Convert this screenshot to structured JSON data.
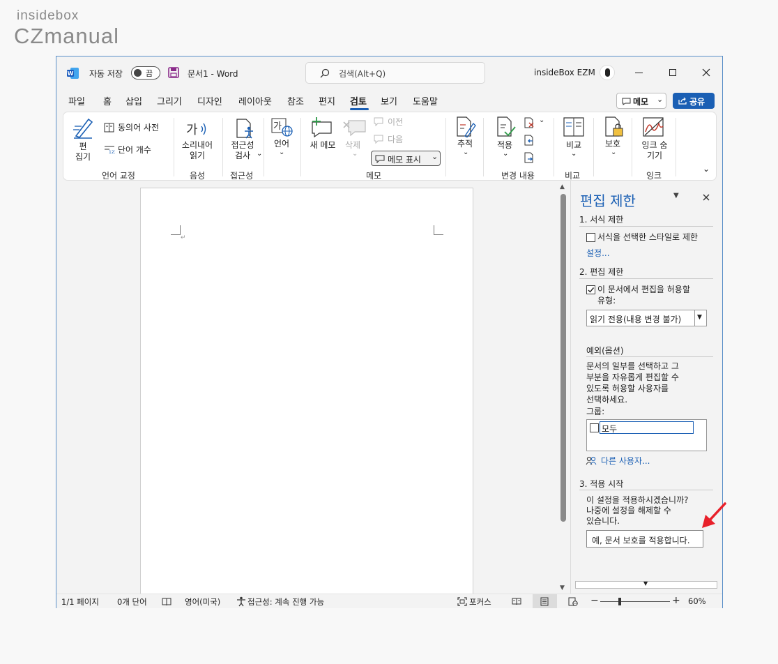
{
  "brand": {
    "line1": "insidebox",
    "line2": "CZmanual"
  },
  "titlebar": {
    "autosave_label": "자동 저장",
    "autosave_state": "끔",
    "doc_title": "문서1  -  Word",
    "search_placeholder": "검색(Alt+Q)",
    "user": "insideBox EZM"
  },
  "menu": {
    "tabs": [
      "파일",
      "홈",
      "삽입",
      "그리기",
      "디자인",
      "레이아웃",
      "참조",
      "편지",
      "검토",
      "보기",
      "도움말"
    ],
    "active": "검토",
    "memo_button": "메모",
    "share_button": "공유"
  },
  "ribbon": {
    "proofing": {
      "editor": "편\n집기",
      "thesaurus": "동의어 사전",
      "word_count": "단어 개수",
      "group": "언어 교정"
    },
    "speech": {
      "read_aloud": "소리내어\n읽기",
      "group": "음성"
    },
    "accessibility": {
      "check": "접근성\n검사",
      "group": "접근성"
    },
    "language": {
      "language": "언어"
    },
    "comments": {
      "new": "새 메모",
      "delete": "삭제",
      "prev": "이전",
      "next": "다음",
      "show": "메모 표시",
      "group": "메모"
    },
    "tracking": {
      "tracking": "추적",
      "accept": "적용",
      "group": "변경 내용"
    },
    "compare": {
      "compare": "비교",
      "group": "비교"
    },
    "protect": {
      "protect": "보호"
    },
    "ink": {
      "hide_ink": "잉크 숨\n기기",
      "group": "잉크"
    }
  },
  "pane": {
    "title": "편집 제한",
    "section1": "1. 서식 제한",
    "format_check": "서식을 선택한 스타일로 제한",
    "settings_link": "설정...",
    "section2": "2. 편집 제한",
    "edit_check": "이 문서에서 편집을 허용할",
    "edit_type_label": "유형:",
    "edit_type_value": "읽기 전용(내용 변경 불가)",
    "exceptions_label": "예외(옵션)",
    "exceptions_desc": "문서의 일부를 선택하고 그\n부분을 자유롭게 편집할 수\n있도록 허용할 사용자를\n선택하세요.",
    "groups_label": "그룹:",
    "group_everyone": "모두",
    "more_users_link": "다른 사용자...",
    "section3": "3. 적용 시작",
    "apply_question": "이 설정을 적용하시겠습니까?\n나중에 설정을 해제할 수\n있습니다.",
    "apply_button": "예, 문서 보호를 적용합니다."
  },
  "status": {
    "page": "1/1 페이지",
    "words": "0개 단어",
    "language": "영어(미국)",
    "accessibility": "접근성: 계속 진행 가능",
    "focus": "포커스",
    "zoom_minus": "−",
    "zoom_plus": "+",
    "zoom": "60%"
  },
  "colors": {
    "accent": "#1a5fb4",
    "arrow": "#e8202a"
  }
}
